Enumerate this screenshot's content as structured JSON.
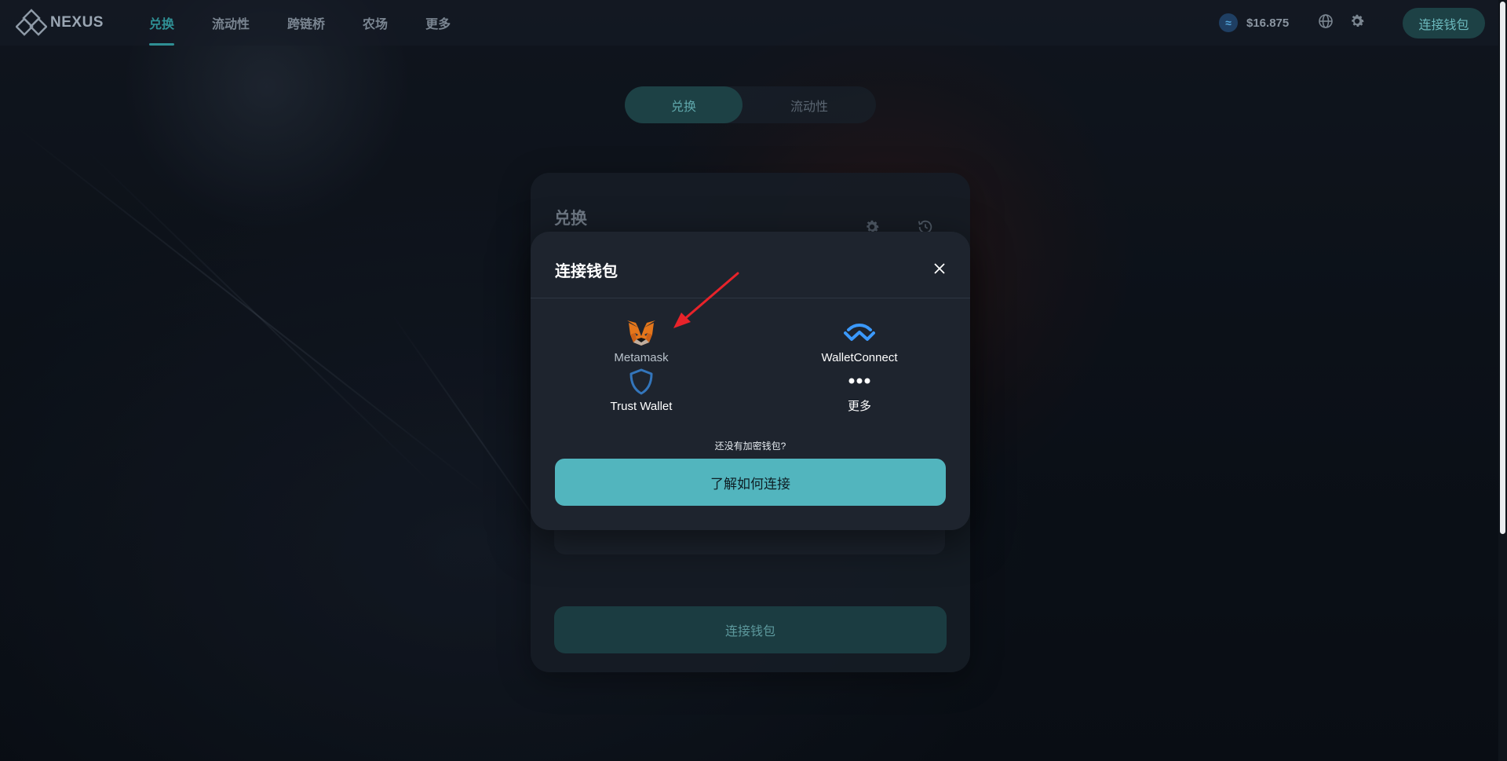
{
  "header": {
    "logo_text": "NEXUS",
    "nav": [
      {
        "label": "兑换",
        "active": true
      },
      {
        "label": "流动性",
        "active": false
      },
      {
        "label": "跨链桥",
        "active": false
      },
      {
        "label": "农场",
        "active": false
      },
      {
        "label": "更多",
        "active": false
      }
    ],
    "price": "$16.875",
    "connect_label": "连接钱包"
  },
  "toggle": {
    "swap_label": "兑换",
    "liquidity_label": "流动性"
  },
  "swap_card": {
    "title": "兑换",
    "connect_label": "连接钱包"
  },
  "modal": {
    "title": "连接钱包",
    "wallets": [
      {
        "name": "Metamask",
        "icon": "metamask-fox-icon"
      },
      {
        "name": "WalletConnect",
        "icon": "walletconnect-icon"
      },
      {
        "name": "Trust Wallet",
        "icon": "trust-wallet-shield-icon"
      },
      {
        "name": "更多",
        "icon": "more-dots-icon"
      }
    ],
    "no_wallet_text": "还没有加密钱包?",
    "learn_label": "了解如何连接"
  },
  "colors": {
    "accent": "#2f8f94",
    "learn_button": "#52b5be",
    "modal_bg": "#1e242e",
    "annotation_arrow": "#e8232a"
  }
}
